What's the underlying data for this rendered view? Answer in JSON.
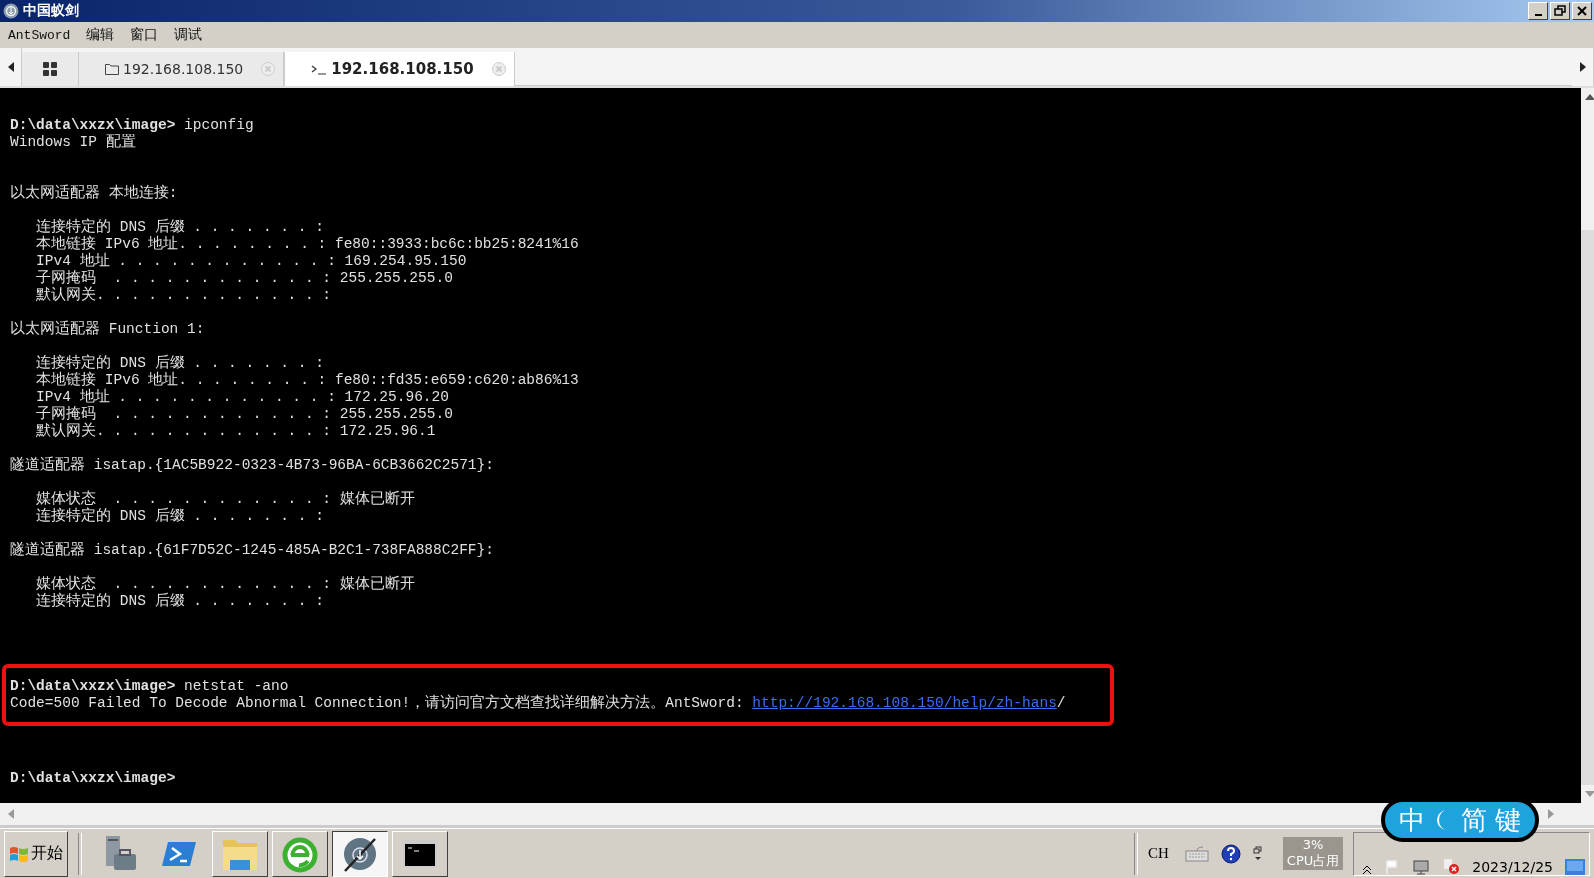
{
  "window": {
    "title": "中国蚁剑"
  },
  "menu": [
    "AntSword",
    "编辑",
    "窗口",
    "调试"
  ],
  "tabs": [
    {
      "kind": "grid",
      "selected": false
    },
    {
      "kind": "folder",
      "label": "192.168.108.150",
      "selected": false
    },
    {
      "kind": "terminal",
      "label": "192.168.108.150",
      "selected": true
    }
  ],
  "terminal": {
    "blocks": [
      {
        "kind": "plain",
        "lines": [
          {
            "kind": "text",
            "text": "**D:\\data\\xxzx\\image>** ipconfig"
          },
          {
            "kind": "text",
            "text": "Windows IP 配置"
          },
          {
            "kind": "blank"
          },
          {
            "kind": "blank"
          },
          {
            "kind": "text",
            "text": "以太网适配器 本地连接:"
          },
          {
            "kind": "blank"
          },
          {
            "kind": "text",
            "text": "   连接特定的 DNS 后缀 . . . . . . . :"
          },
          {
            "kind": "text",
            "text": "   本地链接 IPv6 地址. . . . . . . . : fe80::3933:bc6c:bb25:8241%16"
          },
          {
            "kind": "text",
            "text": "   IPv4 地址 . . . . . . . . . . . . : 169.254.95.150"
          },
          {
            "kind": "text",
            "text": "   子网掩码  . . . . . . . . . . . . : 255.255.255.0"
          },
          {
            "kind": "text",
            "text": "   默认网关. . . . . . . . . . . . . :"
          },
          {
            "kind": "blank"
          },
          {
            "kind": "text",
            "text": "以太网适配器 Function 1:"
          },
          {
            "kind": "blank"
          },
          {
            "kind": "text",
            "text": "   连接特定的 DNS 后缀 . . . . . . . :"
          },
          {
            "kind": "text",
            "text": "   本地链接 IPv6 地址. . . . . . . . : fe80::fd35:e659:c620:ab86%13"
          },
          {
            "kind": "text",
            "text": "   IPv4 地址 . . . . . . . . . . . . : 172.25.96.20"
          },
          {
            "kind": "text",
            "text": "   子网掩码  . . . . . . . . . . . . : 255.255.255.0"
          },
          {
            "kind": "text",
            "text": "   默认网关. . . . . . . . . . . . . : 172.25.96.1"
          },
          {
            "kind": "blank"
          },
          {
            "kind": "text",
            "text": "隧道适配器 isatap.{1AC5B922-0323-4B73-96BA-6CB3662C2571}:"
          },
          {
            "kind": "blank"
          },
          {
            "kind": "text",
            "text": "   媒体状态  . . . . . . . . . . . . : 媒体已断开"
          },
          {
            "kind": "text",
            "text": "   连接特定的 DNS 后缀 . . . . . . . :"
          },
          {
            "kind": "blank"
          },
          {
            "kind": "text",
            "text": "隧道适配器 isatap.{61F7D52C-1245-485A-B2C1-738FA888C2FF}:"
          },
          {
            "kind": "blank"
          },
          {
            "kind": "text",
            "text": "   媒体状态  . . . . . . . . . . . . : 媒体已断开"
          },
          {
            "kind": "text",
            "text": "   连接特定的 DNS 后缀 . . . . . . . :"
          },
          {
            "kind": "blank"
          },
          {
            "kind": "blank"
          },
          {
            "kind": "blank"
          },
          {
            "kind": "blank"
          }
        ]
      },
      {
        "kind": "highlighted",
        "lines": [
          {
            "kind": "text",
            "text": "**D:\\data\\xxzx\\image>** netstat -ano"
          },
          {
            "kind": "error",
            "text": "Code=500 Failed To Decode Abnormal Connection!，请访问官方文档查找详细解决方法。AntSword: ",
            "link": "http://192.168.108.150/help/zh-hans",
            "after": "/"
          }
        ]
      },
      {
        "kind": "plain",
        "lines": [
          {
            "kind": "blank"
          },
          {
            "kind": "blank"
          },
          {
            "kind": "blank"
          },
          {
            "kind": "text",
            "text": "**D:\\data\\xxzx\\image>**"
          }
        ]
      }
    ]
  },
  "taskbar": {
    "start": "开始",
    "apps": [
      {
        "kind": "server",
        "selected": false
      },
      {
        "kind": "powershell",
        "selected": false
      },
      {
        "kind": "explorer",
        "selected": false
      },
      {
        "kind": "browser",
        "selected": false
      },
      {
        "kind": "antsword",
        "selected": true
      },
      {
        "kind": "cmd",
        "selected": false
      }
    ],
    "language": "CH",
    "cpu_percent": "3%",
    "cpu_label": "CPU占用",
    "date": "2023/12/25"
  },
  "ime": {
    "mode": "中",
    "script": "简",
    "keys": "键"
  }
}
